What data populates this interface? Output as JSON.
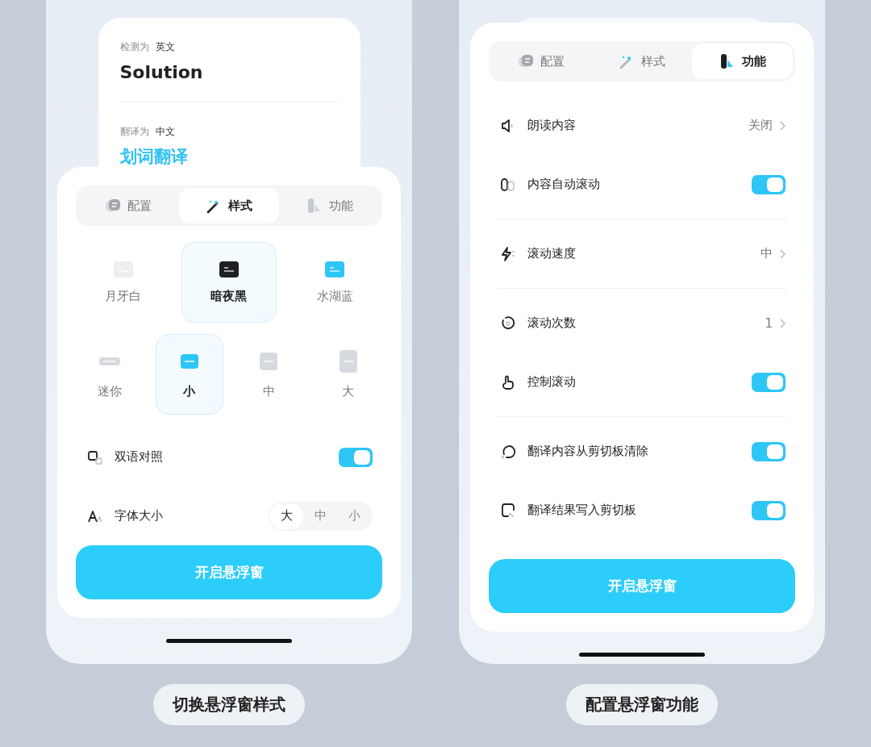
{
  "screens": [
    {
      "kind": "style",
      "result_card": {
        "detected_label": "检测为",
        "detected_lang": "英文",
        "source_text": "Solution",
        "target_label": "翻译为",
        "target_lang": "中文",
        "translation": "划词翻译"
      },
      "tabs": [
        {
          "label": "配置",
          "selected": false
        },
        {
          "label": "样式",
          "selected": true
        },
        {
          "label": "功能",
          "selected": false
        }
      ],
      "themes": [
        {
          "label": "月牙白",
          "color": "#eceef0",
          "selected": false
        },
        {
          "label": "暗夜黑",
          "color": "#1e2023",
          "selected": true
        },
        {
          "label": "水湖蓝",
          "color": "#2ec6f6",
          "selected": false
        }
      ],
      "sizes": [
        {
          "label": "迷你",
          "selected": false
        },
        {
          "label": "小",
          "selected": true
        },
        {
          "label": "中",
          "selected": false
        },
        {
          "label": "大",
          "selected": false
        }
      ],
      "groups": [
        [
          {
            "kind": "toggle",
            "label": "双语对照",
            "on": true
          },
          {
            "kind": "segmented",
            "label": "字体大小",
            "options": [
              {
                "label": "大",
                "selected": true
              },
              {
                "label": "中",
                "selected": false
              },
              {
                "label": "小",
                "selected": false
              }
            ]
          }
        ]
      ],
      "button": "开启悬浮窗",
      "caption": "切换悬浮窗样式"
    },
    {
      "kind": "function",
      "tabs": [
        {
          "label": "配置",
          "selected": false
        },
        {
          "label": "样式",
          "selected": false
        },
        {
          "label": "功能",
          "selected": true
        }
      ],
      "groups": [
        [
          {
            "kind": "value",
            "label": "朗读内容",
            "value": "关闭"
          },
          {
            "kind": "toggle",
            "label": "内容自动滚动",
            "on": true
          }
        ],
        [
          {
            "kind": "value",
            "label": "滚动速度",
            "value": "中"
          }
        ],
        [
          {
            "kind": "value",
            "label": "滚动次数",
            "value": "1"
          },
          {
            "kind": "toggle",
            "label": "控制滚动",
            "on": true
          }
        ],
        [
          {
            "kind": "toggle",
            "label": "翻译内容从剪切板清除",
            "on": true
          },
          {
            "kind": "toggle",
            "label": "翻译结果写入剪切板",
            "on": true
          }
        ]
      ],
      "button": "开启悬浮窗",
      "caption": "配置悬浮窗功能"
    }
  ]
}
